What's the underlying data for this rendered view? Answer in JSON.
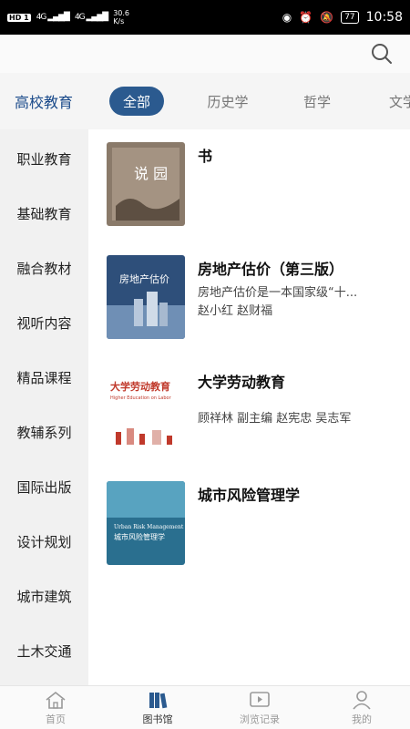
{
  "status_bar": {
    "network_badge": "HD 1",
    "signal_1": "4G",
    "signal_2": "4G",
    "speed_value": "30.6",
    "speed_unit": "K/s",
    "battery": "77",
    "time": "10:58"
  },
  "header": {
    "search_icon": "search-icon"
  },
  "main_category": "高校教育",
  "tabs": [
    {
      "label": "全部",
      "active": true
    },
    {
      "label": "历史学",
      "active": false
    },
    {
      "label": "哲学",
      "active": false
    },
    {
      "label": "文学",
      "active": false
    }
  ],
  "sidebar": {
    "items": [
      {
        "label": "职业教育"
      },
      {
        "label": "基础教育"
      },
      {
        "label": "融合教材"
      },
      {
        "label": "视听内容"
      },
      {
        "label": "精品课程"
      },
      {
        "label": "教辅系列"
      },
      {
        "label": "国际出版"
      },
      {
        "label": "设计规划"
      },
      {
        "label": "城市建筑"
      },
      {
        "label": "土木交通"
      }
    ]
  },
  "books": [
    {
      "title": "书",
      "description": "",
      "authors": "",
      "cover_text": "说 园",
      "cover_colors": [
        "#8a7a6a",
        "#5d4f42"
      ]
    },
    {
      "title": "房地产估价（第三版）",
      "description": "房地产估价是一本国家级“十...",
      "authors": "赵小红  赵财福",
      "cover_text": "房地产估价",
      "cover_colors": [
        "#2e4f7a",
        "#6f8fb5"
      ]
    },
    {
      "title": "大学劳动教育",
      "description": "",
      "authors": "顾祥林 副主编 赵宪忠 吴志军",
      "cover_text": "大学劳动教育",
      "cover_subtext": "Higher Education on Labor",
      "cover_colors": [
        "#ffffff",
        "#c0392b"
      ]
    },
    {
      "title": "城市风险管理学",
      "description": "",
      "authors": "",
      "cover_text": "城市风险管理学",
      "cover_subtext": "Urban Risk Management",
      "cover_colors": [
        "#2a6f8f",
        "#58a3c0"
      ]
    }
  ],
  "bottom_nav": [
    {
      "label": "首页",
      "icon": "home-icon",
      "active": false
    },
    {
      "label": "图书馆",
      "icon": "library-icon",
      "active": true
    },
    {
      "label": "浏览记录",
      "icon": "history-icon",
      "active": false
    },
    {
      "label": "我的",
      "icon": "profile-icon",
      "active": false
    }
  ],
  "colors": {
    "accent": "#2b5a8f",
    "main_category_text": "#1a4a8a",
    "sidebar_bg": "#f1f1f1"
  }
}
